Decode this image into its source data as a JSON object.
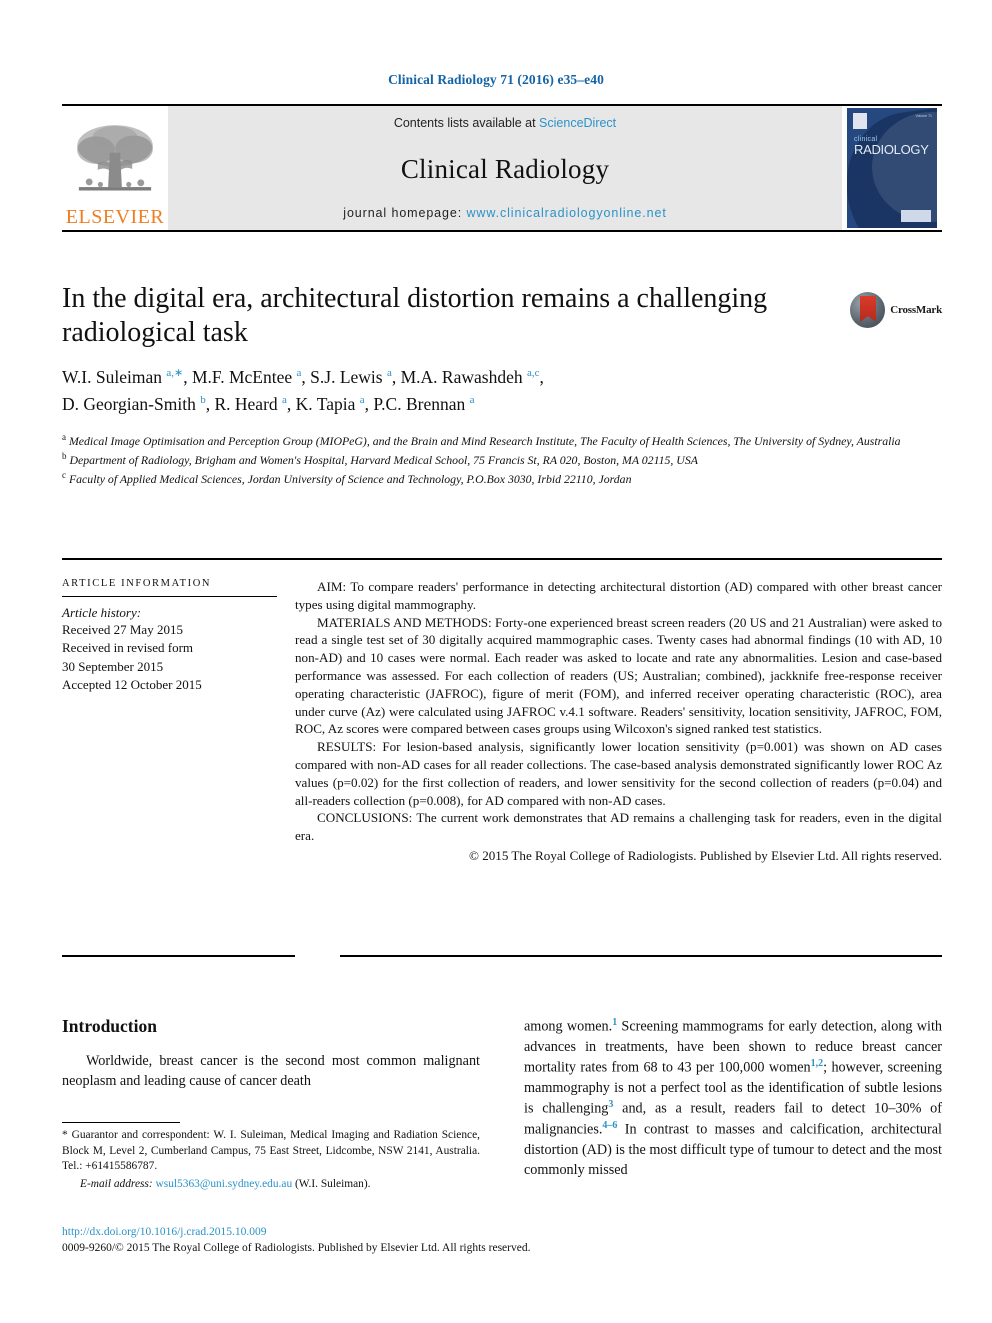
{
  "running_head": "Clinical Radiology 71 (2016) e35–e40",
  "masthead": {
    "elsevier_wordmark": "ELSEVIER",
    "contents_prefix": "Contents lists available at ",
    "contents_link": "ScienceDirect",
    "journal_name": "Clinical Radiology",
    "homepage_prefix": "journal homepage: ",
    "homepage_url": "www.clinicalradiologyonline.net",
    "cover": {
      "title_small": "clinical",
      "title_big": "RADIOLOGY",
      "corner_text": "Volume 71"
    },
    "colors": {
      "link": "#2b93c8",
      "elsevier_orange": "#ef7d22",
      "masthead_background": "#e7e7e7",
      "cover_navy": "#24487f"
    }
  },
  "article": {
    "title": "In the digital era, architectural distortion remains a challenging radiological task",
    "crossmark_label": "CrossMark",
    "authors_line1": "W.I. Suleiman <sup>a,∗</sup>, M.F. McEntee <sup>a</sup>, S.J. Lewis <sup>a</sup>, M.A. Rawashdeh <sup>a,c</sup>,",
    "authors_line2": "D. Georgian-Smith <sup>b</sup>, R. Heard <sup>a</sup>, K. Tapia <sup>a</sup>, P.C. Brennan <sup>a</sup>",
    "affiliations": [
      "a Medical Image Optimisation and Perception Group (MIOPeG), and the Brain and Mind Research Institute, The Faculty of Health Sciences, The University of Sydney, Australia",
      "b Department of Radiology, Brigham and Women's Hospital, Harvard Medical School, 75 Francis St, RA 020, Boston, MA 02115, USA",
      "c Faculty of Applied Medical Sciences, Jordan University of Science and Technology, P.O.Box 3030, Irbid 22110, Jordan"
    ]
  },
  "article_information": {
    "heading": "ARTICLE INFORMATION",
    "history_label": "Article history:",
    "history": [
      "Received 27 May 2015",
      "Received in revised form",
      "30 September 2015",
      "Accepted 12 October 2015"
    ]
  },
  "abstract": {
    "aim_label": "AIM:",
    "aim_text": " To compare readers' performance in detecting architectural distortion (AD) compared with other breast cancer types using digital mammography.",
    "methods_label": "MATERIALS AND METHODS:",
    "methods_text": " Forty-one experienced breast screen readers (20 US and 21 Australian) were asked to read a single test set of 30 digitally acquired mammographic cases. Twenty cases had abnormal findings (10 with AD, 10 non-AD) and 10 cases were normal. Each reader was asked to locate and rate any abnormalities. Lesion and case-based performance was assessed. For each collection of readers (US; Australian; combined), jackknife free-response receiver operating characteristic (JAFROC), figure of merit (FOM), and inferred receiver operating characteristic (ROC), area under curve (Az) were calculated using JAFROC v.4.1 software. Readers' sensitivity, location sensitivity, JAFROC, FOM, ROC, Az scores were compared between cases groups using Wilcoxon's signed ranked test statistics.",
    "results_label": "RESULTS:",
    "results_text": " For lesion-based analysis, significantly lower location sensitivity (p=0.001) was shown on AD cases compared with non-AD cases for all reader collections. The case-based analysis demonstrated significantly lower ROC Az values (p=0.02) for the first collection of readers, and lower sensitivity for the second collection of readers (p=0.04) and all-readers collection (p=0.008), for AD compared with non-AD cases.",
    "conclusions_label": "CONCLUSIONS:",
    "conclusions_text": " The current work demonstrates that AD remains a challenging task for readers, even in the digital era.",
    "copyright": "© 2015 The Royal College of Radiologists. Published by Elsevier Ltd. All rights reserved."
  },
  "body": {
    "introduction_heading": "Introduction",
    "left_paragraph": "Worldwide, breast cancer is the second most common malignant neoplasm and leading cause of cancer death",
    "right_paragraph_parts": {
      "p1": "among women.",
      "ref1": "1",
      "p2": " Screening mammograms for early detection, along with advances in treatments, have been shown to reduce breast cancer mortality rates from 68 to 43 per 100,000 women",
      "ref2": "1,2",
      "p3": "; however, screening mammography is not a perfect tool as the identification of subtle lesions is challenging",
      "ref3": "3",
      "p4": " and, as a result, readers fail to detect 10–30% of malignancies.",
      "ref4": "4–6",
      "p5": " In contrast to masses and calcification, architectural distortion (AD) is the most difficult type of tumour to detect and the most commonly missed"
    }
  },
  "footnote": {
    "guarantor": "* Guarantor and correspondent: W. I. Suleiman, Medical Imaging and Radiation Science, Block M, Level 2, Cumberland Campus, 75 East Street, Lidcombe, NSW 2141, Australia. Tel.: +61415586787.",
    "email_label": "E-mail address:",
    "email_address": "wsul5363@uni.sydney.edu.au",
    "email_suffix": "(W.I. Suleiman)."
  },
  "imprint": {
    "doi": "http://dx.doi.org/10.1016/j.crad.2015.10.009",
    "copyright": "0009-9260/© 2015 The Royal College of Radiologists. Published by Elsevier Ltd. All rights reserved."
  }
}
